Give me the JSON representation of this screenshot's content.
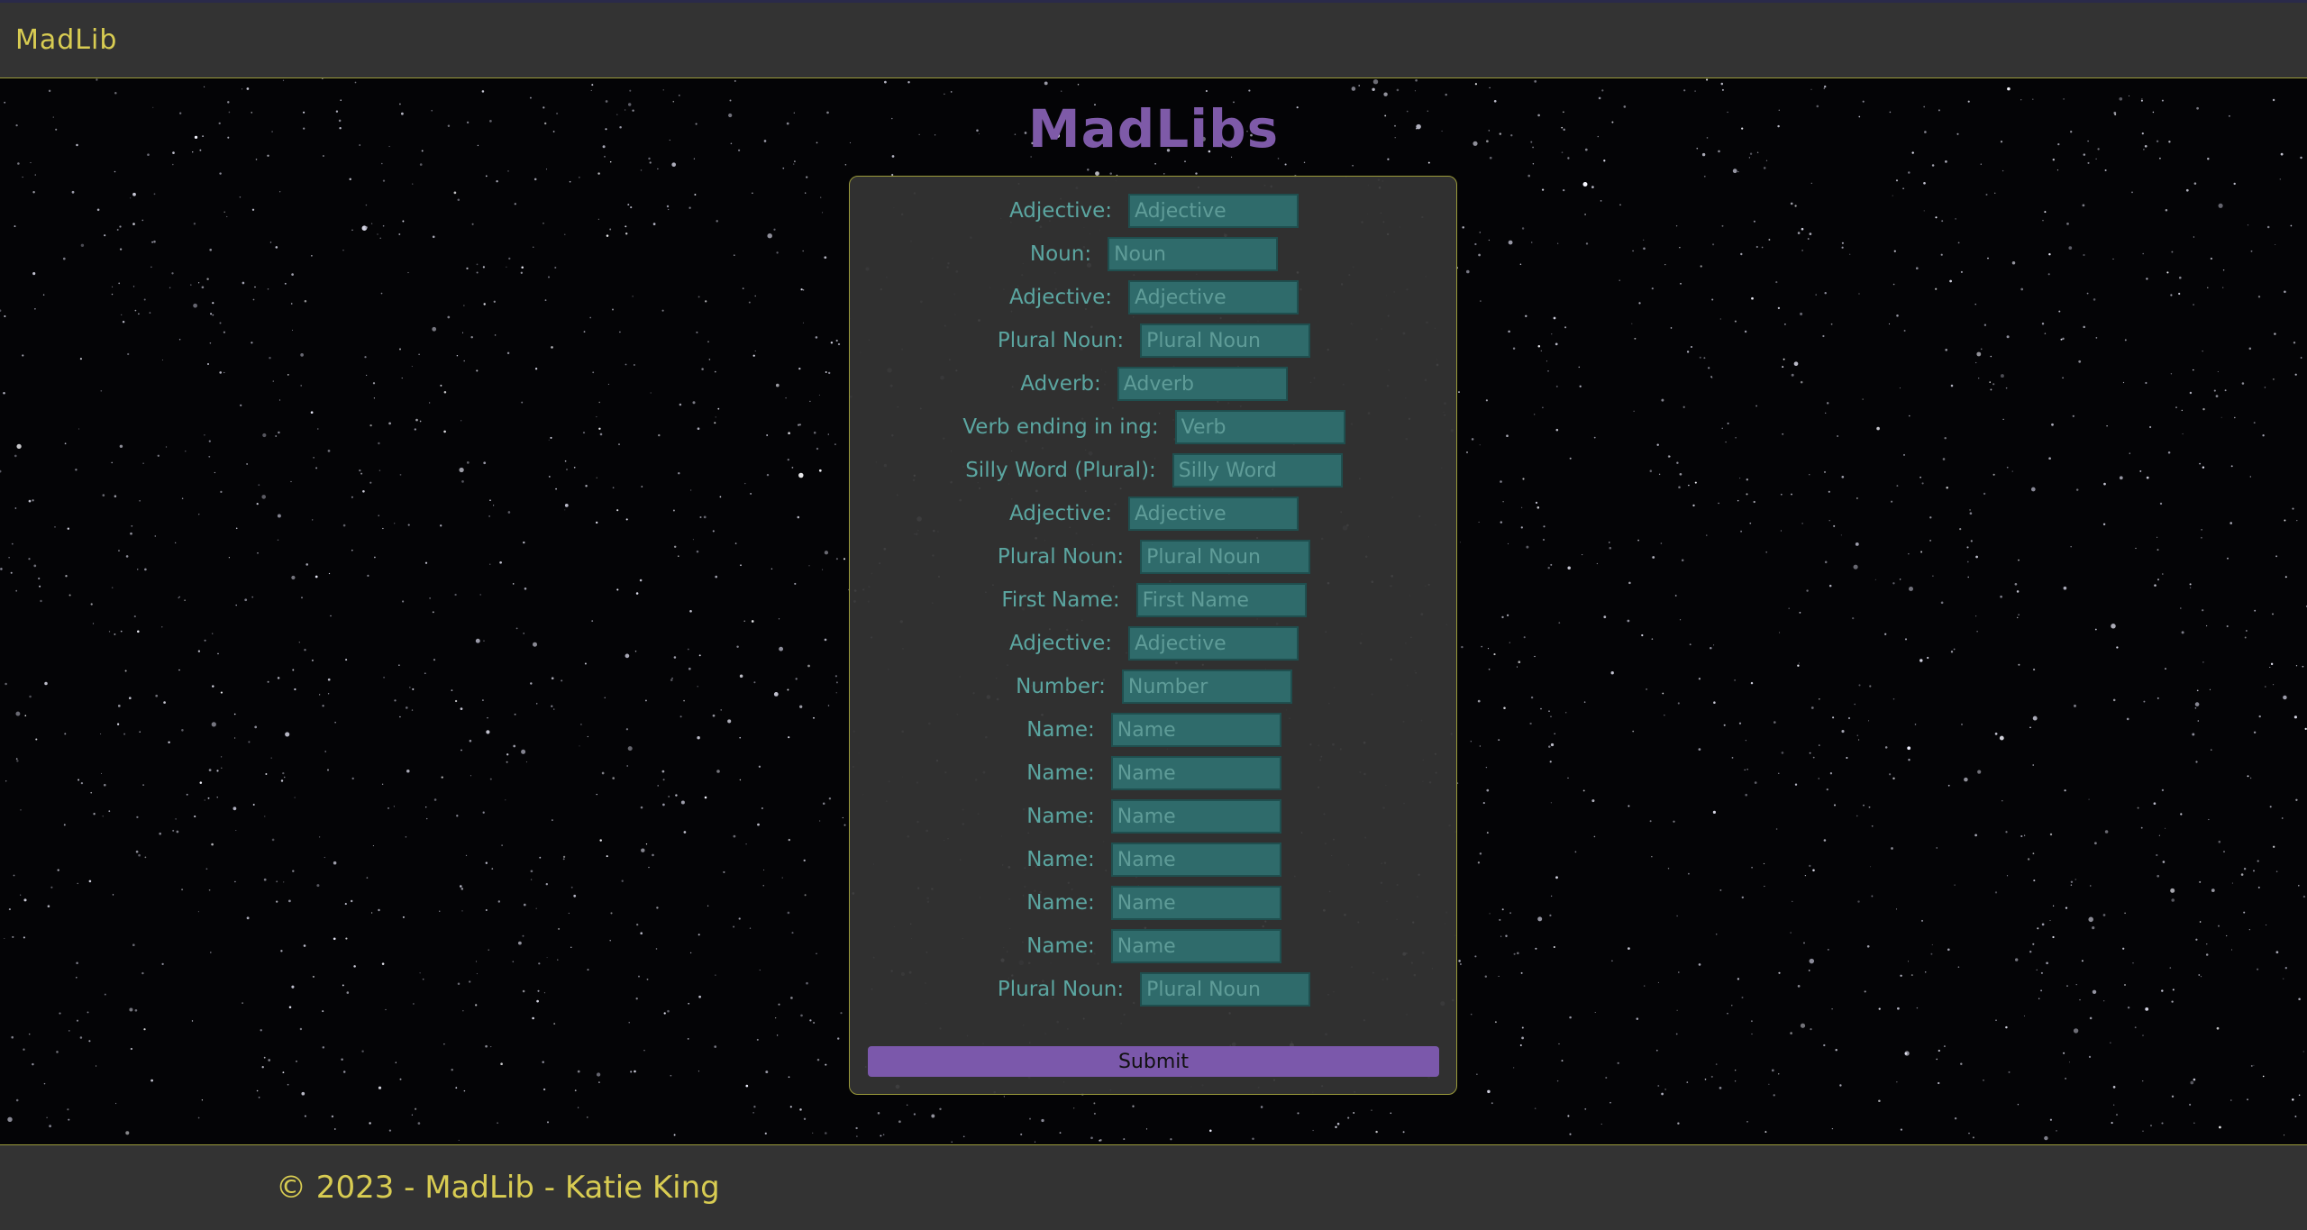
{
  "navbar": {
    "brand": "MadLib"
  },
  "main": {
    "title": "MadLibs"
  },
  "form": {
    "fields": [
      {
        "label": "Adjective:",
        "placeholder": "Adjective"
      },
      {
        "label": "Noun:",
        "placeholder": "Noun"
      },
      {
        "label": "Adjective:",
        "placeholder": "Adjective"
      },
      {
        "label": "Plural Noun:",
        "placeholder": "Plural Noun"
      },
      {
        "label": "Adverb:",
        "placeholder": "Adverb"
      },
      {
        "label": "Verb ending in ing:",
        "placeholder": "Verb"
      },
      {
        "label": "Silly Word (Plural):",
        "placeholder": "Silly Word"
      },
      {
        "label": "Adjective:",
        "placeholder": "Adjective"
      },
      {
        "label": "Plural Noun:",
        "placeholder": "Plural Noun"
      },
      {
        "label": "First Name:",
        "placeholder": "First Name"
      },
      {
        "label": "Adjective:",
        "placeholder": "Adjective"
      },
      {
        "label": "Number:",
        "placeholder": "Number"
      },
      {
        "label": "Name:",
        "placeholder": "Name"
      },
      {
        "label": "Name:",
        "placeholder": "Name"
      },
      {
        "label": "Name:",
        "placeholder": "Name"
      },
      {
        "label": "Name:",
        "placeholder": "Name"
      },
      {
        "label": "Name:",
        "placeholder": "Name"
      },
      {
        "label": "Name:",
        "placeholder": "Name"
      },
      {
        "label": "Plural Noun:",
        "placeholder": "Plural Noun"
      }
    ],
    "submit_label": "Submit"
  },
  "footer": {
    "text": "© 2023 - MadLib - Katie King"
  },
  "colors": {
    "accent": "#d8cc52",
    "title": "#7e5aa8",
    "field_bg": "#2f6b6b",
    "label": "#5ba6a1",
    "button": "#7b58ab",
    "panel": "#333333"
  }
}
